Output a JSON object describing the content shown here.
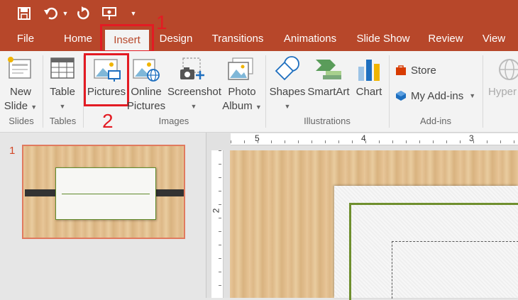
{
  "titlebar": {
    "icons": [
      "save-icon",
      "undo-icon",
      "redo-icon",
      "present-icon",
      "customize-qat-icon"
    ],
    "color": "#b7472a"
  },
  "tabs": [
    {
      "label": "File"
    },
    {
      "label": "Home"
    },
    {
      "label": "Insert",
      "active": true
    },
    {
      "label": "Design"
    },
    {
      "label": "Transitions"
    },
    {
      "label": "Animations"
    },
    {
      "label": "Slide Show"
    },
    {
      "label": "Review"
    },
    {
      "label": "View"
    }
  ],
  "annotations": {
    "step1": "1",
    "step2": "2",
    "color": "#e31b23"
  },
  "ribbon": {
    "new_slide": {
      "line1": "New",
      "line2": "Slide"
    },
    "table": {
      "label": "Table"
    },
    "pictures": {
      "label": "Pictures"
    },
    "online_pictures": {
      "line1": "Online",
      "line2": "Pictures"
    },
    "screenshot": {
      "label": "Screenshot"
    },
    "photo_album": {
      "line1": "Photo",
      "line2": "Album"
    },
    "shapes": {
      "label": "Shapes"
    },
    "smartart": {
      "label": "SmartArt"
    },
    "chart": {
      "label": "Chart"
    },
    "store": {
      "label": "Store"
    },
    "my_addins": {
      "label": "My Add-ins"
    },
    "hyperlink": {
      "label": "Hyper"
    },
    "groups": {
      "slides": "Slides",
      "tables": "Tables",
      "images": "Images",
      "illustrations": "Illustrations",
      "addins": "Add-ins"
    }
  },
  "thumbnails": [
    {
      "number": "1"
    }
  ],
  "ruler": {
    "h_ticks": [
      "5",
      "4",
      "3"
    ],
    "v_ticks": [
      "2"
    ]
  }
}
